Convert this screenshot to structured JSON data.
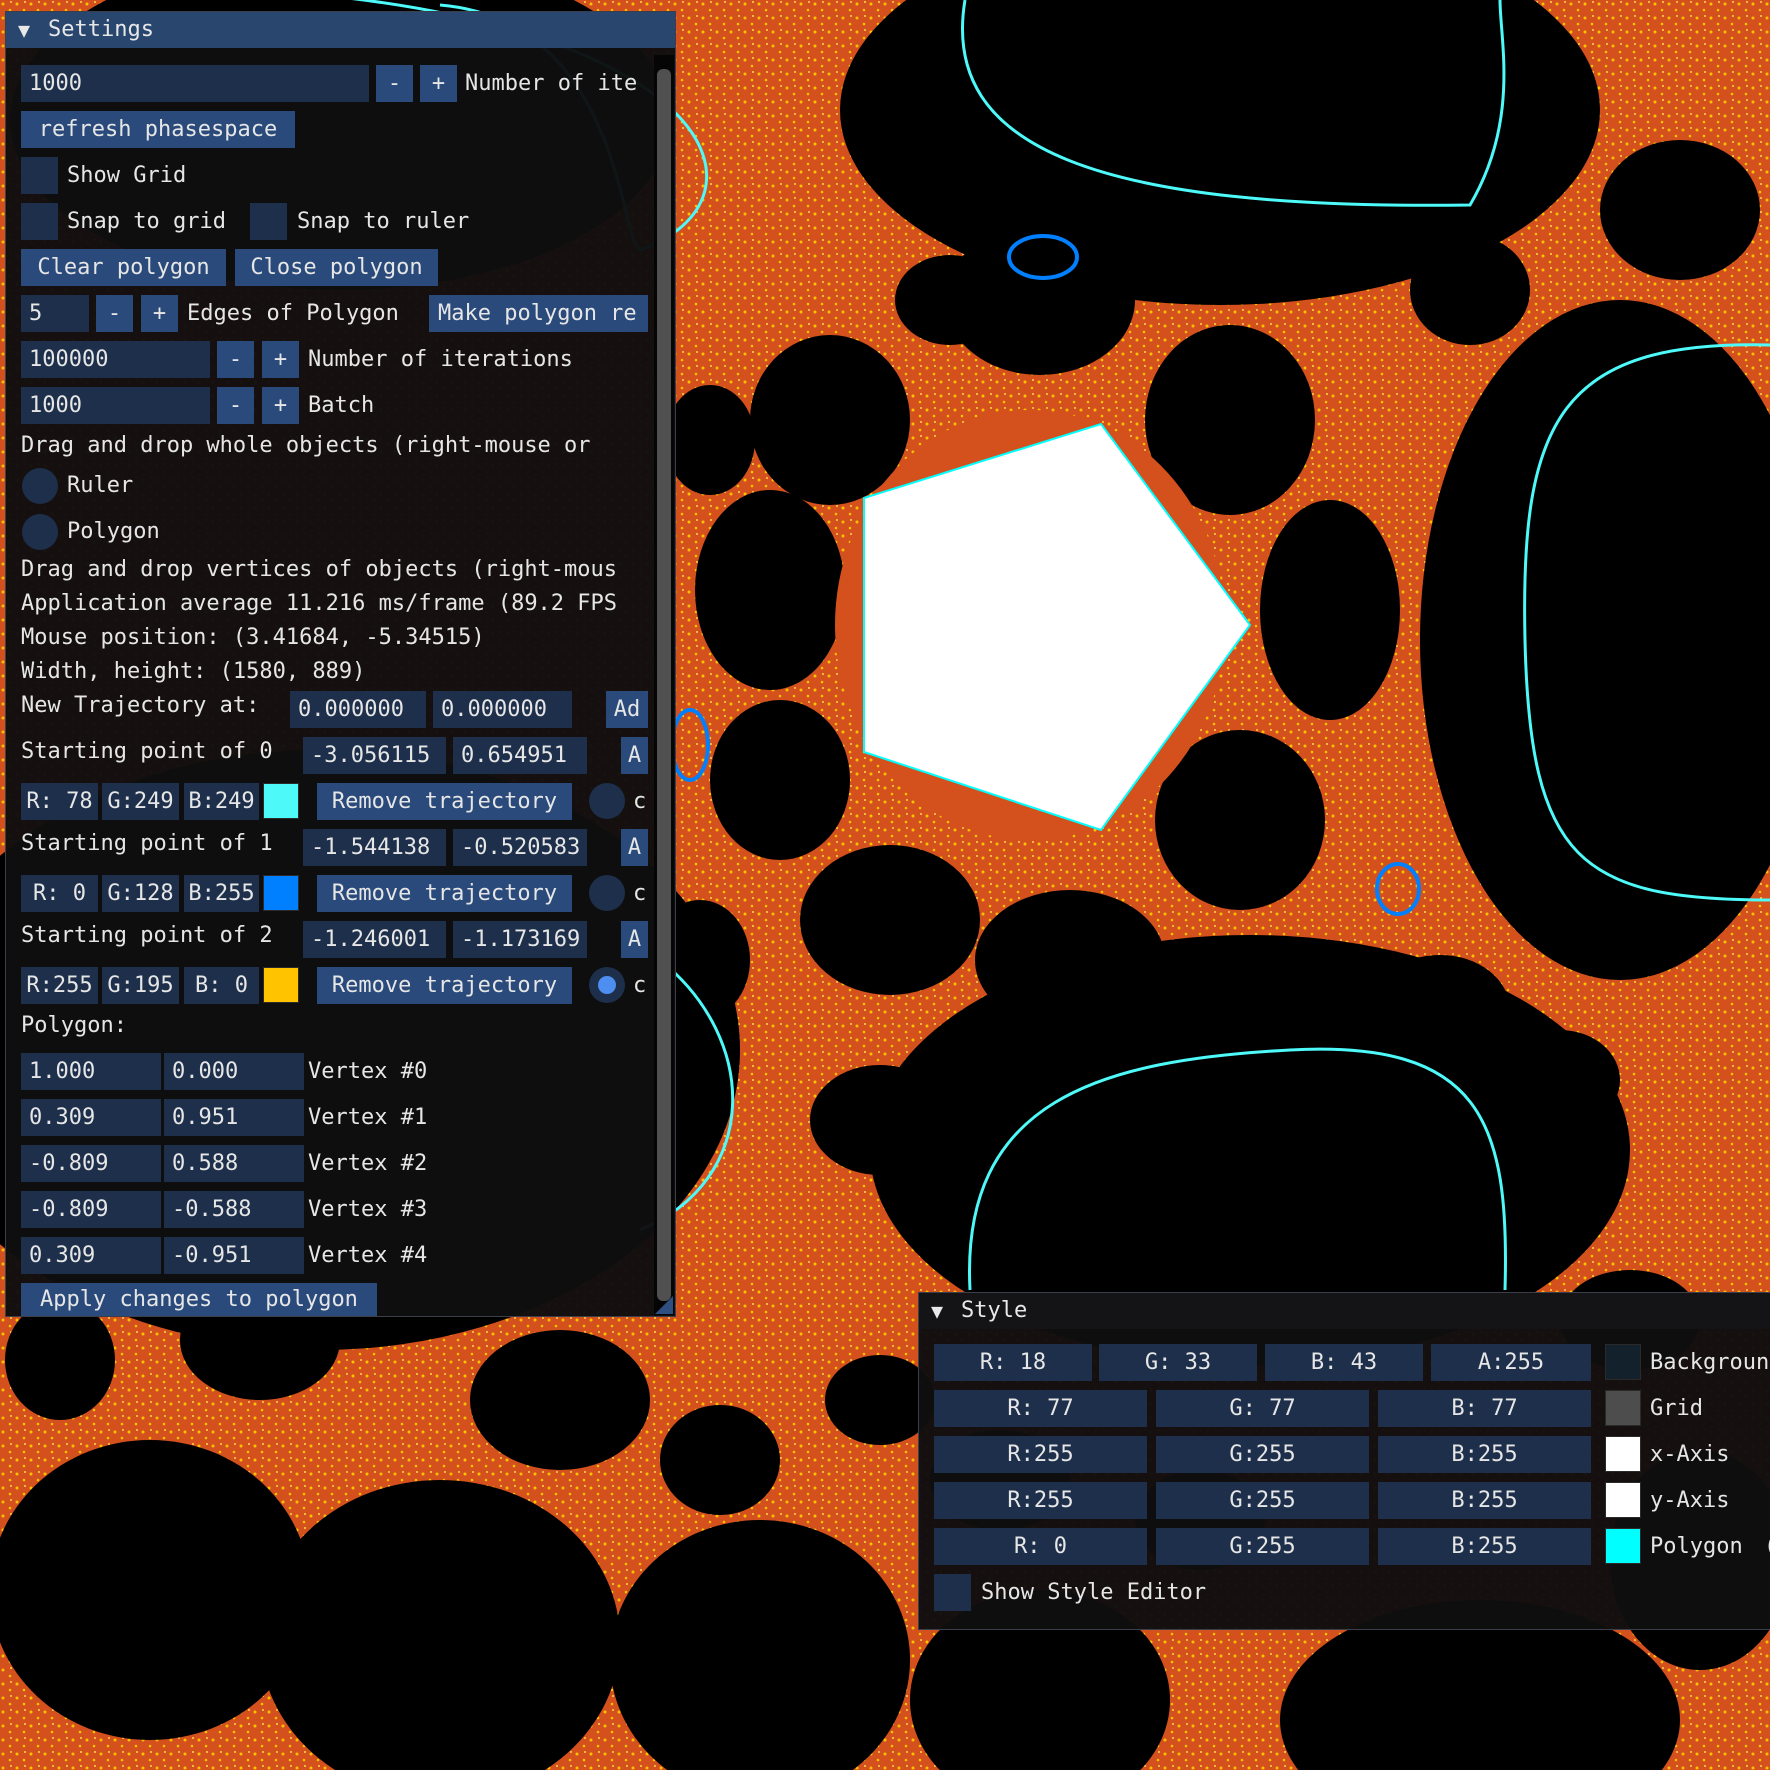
{
  "colors": {
    "orange": "#d4501c",
    "yellow": "#ffc300",
    "cyan": "#4ef9f9",
    "blue": "#0080ff",
    "title_active": "#29466f",
    "frame_bg": "#1d2f4a",
    "button": "#294a7a"
  },
  "settings": {
    "title": "Settings",
    "iterations_top": {
      "value": "1000",
      "minus": "-",
      "plus": "+",
      "label": "Number of ite"
    },
    "refresh_button": "refresh phasespace",
    "show_grid": "Show Grid",
    "snap_grid": "Snap to grid",
    "snap_ruler": "Snap to ruler",
    "clear_polygon": "Clear polygon",
    "close_polygon": "Close polygon",
    "edges": {
      "value": "5",
      "minus": "-",
      "plus": "+",
      "label": "Edges of Polygon"
    },
    "make_regular": "Make polygon re",
    "iterations": {
      "value": "100000",
      "minus": "-",
      "plus": "+",
      "label": "Number of iterations"
    },
    "batch": {
      "value": "1000",
      "minus": "-",
      "plus": "+",
      "label": "Batch"
    },
    "drag_objects": "Drag and drop whole objects (right-mouse or",
    "radio_ruler": "Ruler",
    "radio_polygon": "Polygon",
    "drag_vertices": "Drag and drop vertices of objects (right-mous",
    "fps": "Application average 11.216 ms/frame (89.2 FPS",
    "mouse_pos": "Mouse position: (3.41684, -5.34515)",
    "width_height": "Width, height: (1580, 889)",
    "new_traj": {
      "label": "New Trajectory at:",
      "x": "0.000000",
      "y": "0.000000",
      "add": "Ad"
    },
    "trajectories": [
      {
        "label": "Starting point of 0",
        "x": "-3.056115",
        "y": "0.654951",
        "a": "A",
        "r": "R: 78",
        "g": "G:249",
        "b": "B:249",
        "color": "#4ef9f9",
        "remove": "Remove trajectory",
        "c": "c",
        "selected": false
      },
      {
        "label": "Starting point of 1",
        "x": "-1.544138",
        "y": "-0.520583",
        "a": "A",
        "r": "R:  0",
        "g": "G:128",
        "b": "B:255",
        "color": "#0080ff",
        "remove": "Remove trajectory",
        "c": "c",
        "selected": false
      },
      {
        "label": "Starting point of 2",
        "x": "-1.246001",
        "y": "-1.173169",
        "a": "A",
        "r": "R:255",
        "g": "G:195",
        "b": "B:  0",
        "color": "#ffc300",
        "remove": "Remove trajectory",
        "c": "c",
        "selected": true
      }
    ],
    "polygon_label": "Polygon:",
    "vertices": [
      {
        "x": "1.000",
        "y": "0.000",
        "label": "Vertex #0"
      },
      {
        "x": "0.309",
        "y": "0.951",
        "label": "Vertex #1"
      },
      {
        "x": "-0.809",
        "y": "0.588",
        "label": "Vertex #2"
      },
      {
        "x": "-0.809",
        "y": "-0.588",
        "label": "Vertex #3"
      },
      {
        "x": "0.309",
        "y": "-0.951",
        "label": "Vertex #4"
      }
    ],
    "apply_button": "Apply changes to polygon"
  },
  "style": {
    "title": "Style",
    "background": {
      "r": "R: 18",
      "g": "G: 33",
      "b": "B: 43",
      "a": "A:255",
      "color": "#12212b",
      "label": "Backgroun"
    },
    "rows": [
      {
        "r": "R: 77",
        "g": "G: 77",
        "b": "B: 77",
        "color": "#4d4d4d",
        "label": "Grid"
      },
      {
        "r": "R:255",
        "g": "G:255",
        "b": "B:255",
        "color": "#ffffff",
        "label": "x-Axis"
      },
      {
        "r": "R:255",
        "g": "G:255",
        "b": "B:255",
        "color": "#ffffff",
        "label": "y-Axis"
      },
      {
        "r": "R:  0",
        "g": "G:255",
        "b": "B:255",
        "color": "#00ffff",
        "label": "Polygon"
      }
    ],
    "polygon_extra": "(",
    "show_style_editor": "Show Style Editor"
  }
}
